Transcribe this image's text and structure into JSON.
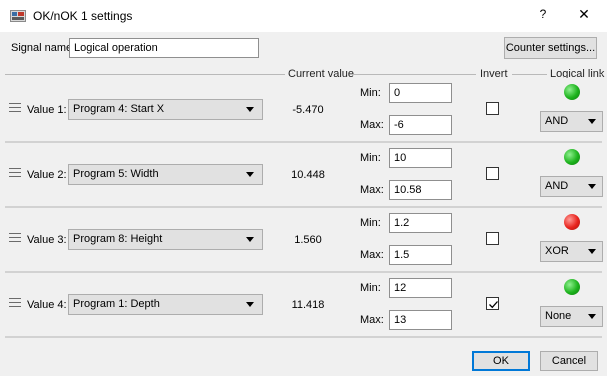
{
  "window": {
    "title": "OK/nOK 1 settings",
    "help_glyph": "?",
    "close_glyph": "✕"
  },
  "signal": {
    "label": "Signal name:",
    "value": "Logical operation",
    "counter_button": "Counter settings..."
  },
  "headers": {
    "current_value": "Current value",
    "invert": "Invert",
    "logical_link": "Logical link"
  },
  "min_label": "Min:",
  "max_label": "Max:",
  "rows": [
    {
      "label": "Value 1:",
      "program": "Program 4: Start X",
      "current": "-5.470",
      "min": "0",
      "max": "-6",
      "invert": false,
      "led_color": "#1db31d",
      "link": "AND"
    },
    {
      "label": "Value 2:",
      "program": "Program 5: Width",
      "current": "10.448",
      "min": "10",
      "max": "10.58",
      "invert": false,
      "led_color": "#1db31d",
      "link": "AND"
    },
    {
      "label": "Value 3:",
      "program": "Program 8: Height",
      "current": "1.560",
      "min": "1.2",
      "max": "1.5",
      "invert": false,
      "led_color": "#e8231d",
      "link": "XOR"
    },
    {
      "label": "Value 4:",
      "program": "Program 1: Depth",
      "current": "11.418",
      "min": "12",
      "max": "13",
      "invert": true,
      "led_color": "#1db31d",
      "link": "None"
    }
  ],
  "footer": {
    "ok": "OK",
    "cancel": "Cancel"
  }
}
